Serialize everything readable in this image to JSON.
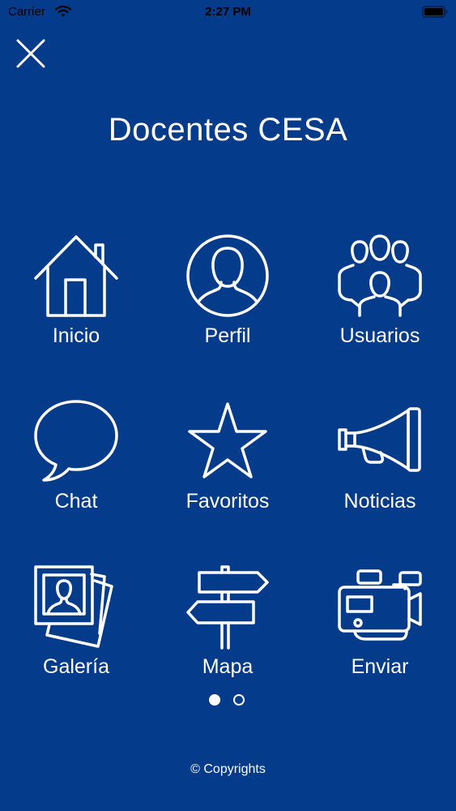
{
  "status_bar": {
    "carrier": "Carrier",
    "time": "2:27 PM"
  },
  "header": {
    "close_icon": "close-icon",
    "title": "Docentes CESA"
  },
  "menu": {
    "items": [
      {
        "label": "Inicio",
        "icon": "house-icon"
      },
      {
        "label": "Perfil",
        "icon": "profile-icon"
      },
      {
        "label": "Usuarios",
        "icon": "users-icon"
      },
      {
        "label": "Chat",
        "icon": "chat-bubble-icon"
      },
      {
        "label": "Favoritos",
        "icon": "star-icon"
      },
      {
        "label": "Noticias",
        "icon": "megaphone-icon"
      },
      {
        "label": "Galería",
        "icon": "photo-gallery-icon"
      },
      {
        "label": "Mapa",
        "icon": "signpost-icon"
      },
      {
        "label": "Enviar",
        "icon": "video-camera-icon"
      }
    ]
  },
  "pagination": {
    "current_page": 1,
    "total_pages": 2
  },
  "footer": {
    "copyright": "© Copyrights"
  },
  "colors": {
    "background": "#043b8b",
    "foreground": "#ffffff"
  }
}
